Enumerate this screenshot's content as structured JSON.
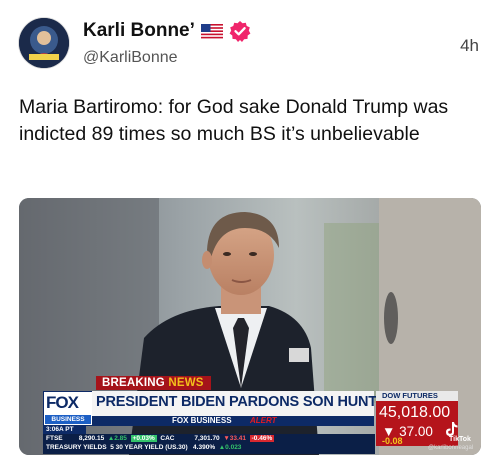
{
  "post": {
    "author_name": "Karli Bonne’",
    "handle": "@KarliBonne",
    "time": "4h",
    "text": "Maria Bartiromo: for God sake Donald Trump was indicted 89 times so much BS it’s unbelievable",
    "flag_icon": "us-flag-icon",
    "verified_icon": "verified-badge-icon"
  },
  "media": {
    "breaking_label": "BREAKING",
    "breaking_accent": "NEWS",
    "network_logo": "FOX",
    "network_sub": "BUSINESS",
    "headline": "PRESIDENT BIDEN PARDONS SON HUNTER",
    "alert_brand": "FOX BUSINESS",
    "alert_word": "ALERT",
    "time_tag": "3:06A PT",
    "ticker_row1": {
      "ftse_label": "FTSE",
      "ftse_value": "8,290.15",
      "ftse_change": "▲2.85",
      "ftse_pct": "+0.03%",
      "cac_label": "CAC",
      "cac_value": "7,301.70",
      "cac_change": "▼33.41",
      "cac_pct": "-0.46%"
    },
    "ticker_row2": {
      "label": "TREASURY YIELDS",
      "item": "5 30 YEAR YIELD (US.30)",
      "value": "4.390%",
      "change": "▲0.023"
    },
    "dow_label": "DOW FUTURES",
    "dow_value": "45,018.00",
    "dow_change": "37.00",
    "dow_pct": "-0.08",
    "tiktok_label": "TikTok",
    "tiktok_user": "@karlibonneagal"
  },
  "colors": {
    "fox_blue": "#0d2a66",
    "breaking_red": "#a5131a",
    "dow_red": "#b5141b",
    "verified_pink": "#f0256b"
  }
}
